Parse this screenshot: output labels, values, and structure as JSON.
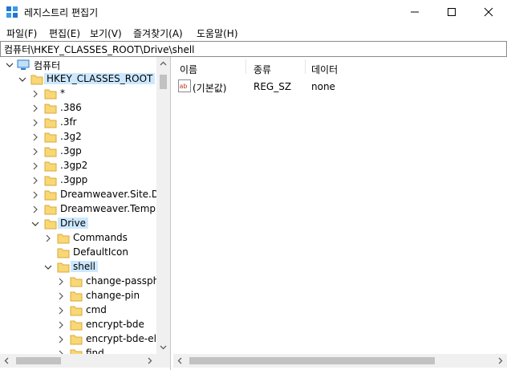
{
  "window": {
    "title": "레지스트리 편집기"
  },
  "menu": [
    "파일(F)",
    "편집(E)",
    "보기(V)",
    "즐겨찾기(A)",
    "도움말(H)"
  ],
  "address": "컴퓨터\\HKEY_CLASSES_ROOT\\Drive\\shell",
  "tree": {
    "root": "컴퓨터",
    "hive": "HKEY_CLASSES_ROOT",
    "items": [
      "*",
      ".386",
      ".3fr",
      ".3g2",
      ".3gp",
      ".3gp2",
      ".3gpp",
      "Dreamweaver.Site.Def",
      "Dreamweaver.Templat"
    ],
    "drive": "Drive",
    "drive_children": [
      "Commands",
      "DefaultIcon"
    ],
    "shell": "shell",
    "shell_children": [
      "change-passphr",
      "change-pin",
      "cmd",
      "encrypt-bde",
      "encrypt-bde-ele",
      "find"
    ]
  },
  "list": {
    "headers": {
      "name": "이름",
      "type": "종류",
      "data": "데이터"
    },
    "rows": [
      {
        "name": "(기본값)",
        "type": "REG_SZ",
        "data": "none"
      }
    ]
  }
}
